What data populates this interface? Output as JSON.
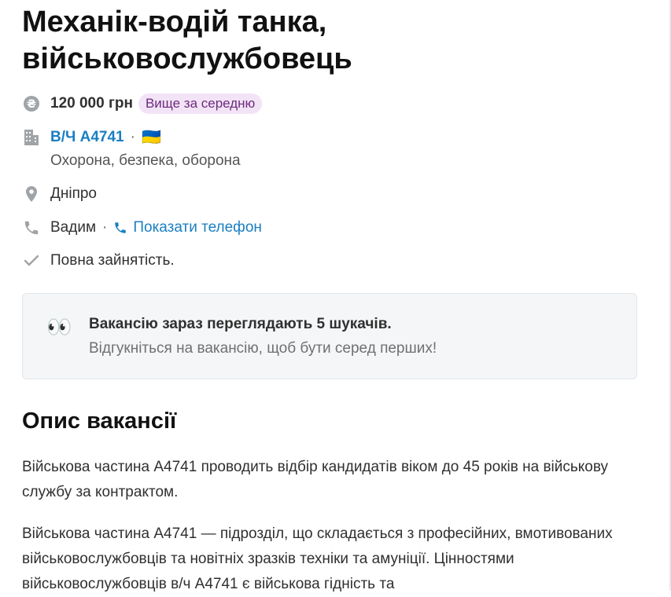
{
  "vacancy": {
    "title": "Механік-водій танка, військовослужбовець",
    "salary": "120 000 грн",
    "salary_badge": "Вище за середню",
    "company": "В/Ч А4741",
    "flag": "🇺🇦",
    "industry": "Охорона, безпека, оборона",
    "city": "Дніпро",
    "contact_name": "Вадим",
    "show_phone": "Показати телефон",
    "employment": "Повна зайнятість."
  },
  "notice": {
    "emoji": "👀",
    "title": "Вакансію зараз переглядають 5 шукачів.",
    "text": "Відгукніться на вакансію, щоб бути серед перших!"
  },
  "description": {
    "heading": "Опис вакансії",
    "paragraphs": [
      "Військова частина А4741 проводить відбір кандидатів віком до 45 років на військову службу за контрактом.",
      "Військова частина А4741 — підрозділ, що складається з професійних, вмотивованих військовослужбовців та новітніх зразків техніки та амуніції. Цінностями військовослужбовців в/ч А4741 є військова гідність та"
    ]
  },
  "colors": {
    "link": "#1a7fc1",
    "badge_bg": "#f3e3f7",
    "badge_text": "#6b2c7a",
    "notice_bg": "#f4f6f8"
  }
}
